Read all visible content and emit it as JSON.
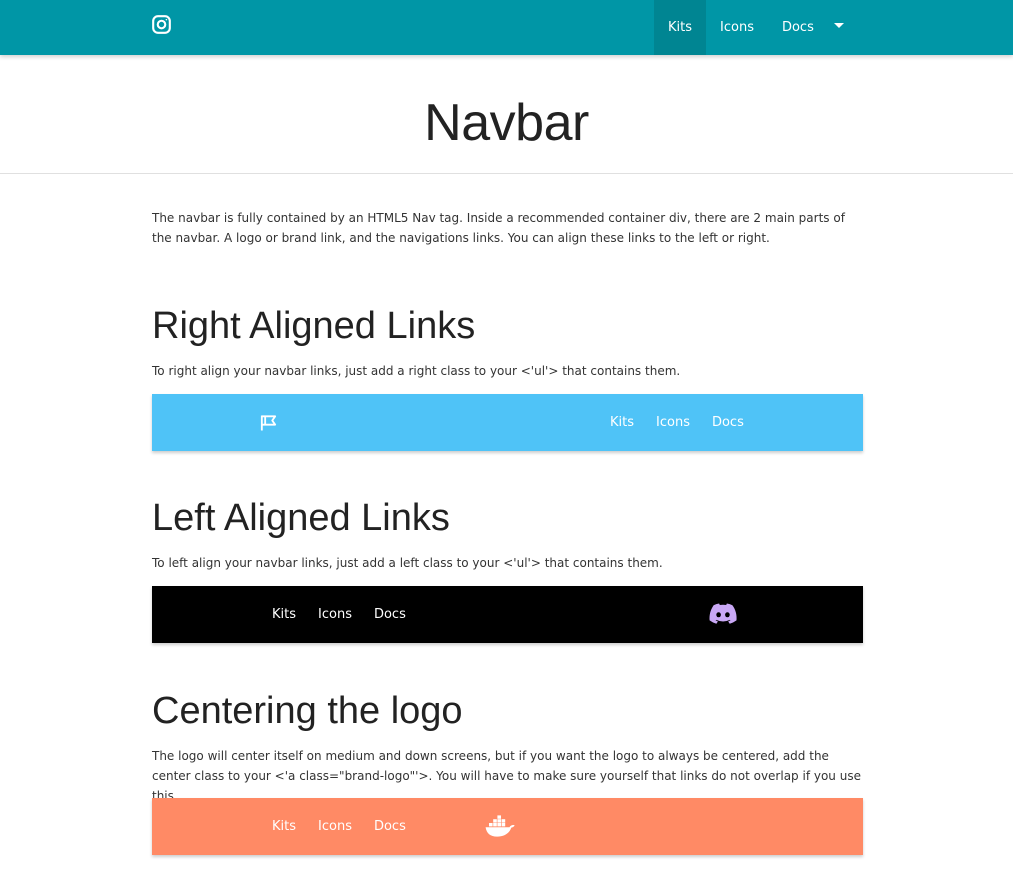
{
  "topnav": {
    "logo_icon": "instagram-icon",
    "links": [
      {
        "label": "Kits",
        "active": true
      },
      {
        "label": "Icons",
        "active": false
      },
      {
        "label": "Docs",
        "active": false
      }
    ],
    "dropdown_icon": "caret-down-icon",
    "color": "#0096a6"
  },
  "header": {
    "title": "Navbar"
  },
  "intro": "The navbar is fully contained by an HTML5 Nav tag. Inside a recommended container div, there are 2 main parts of the navbar. A logo or brand link, and the navigations links. You can align these links to the left or right.",
  "sections": [
    {
      "title": "Right Aligned Links",
      "description": "To right align your navbar links, just add a right class to your <'ul'> that contains them.",
      "demo": {
        "color": "#4fc3f7",
        "logo_icon": "flag-icon",
        "links": [
          "Kits",
          "Icons",
          "Docs"
        ]
      }
    },
    {
      "title": "Left Aligned Links",
      "description": "To left align your navbar links, just add a left class to your <'ul'> that contains them.",
      "demo": {
        "color": "#000000",
        "logo_icon": "discord-icon",
        "links": [
          "Kits",
          "Icons",
          "Docs"
        ]
      }
    },
    {
      "title": "Centering the logo",
      "description": "The logo will center itself on medium and down screens, but if you want the logo to always be centered, add the center class to your <'a class=\"brand-logo\"'>. You will have to make sure yourself that links do not overlap if you use this.",
      "demo": {
        "color": "#ff8a65",
        "logo_icon": "docker-icon",
        "links": [
          "Kits",
          "Icons",
          "Docs"
        ]
      }
    }
  ]
}
